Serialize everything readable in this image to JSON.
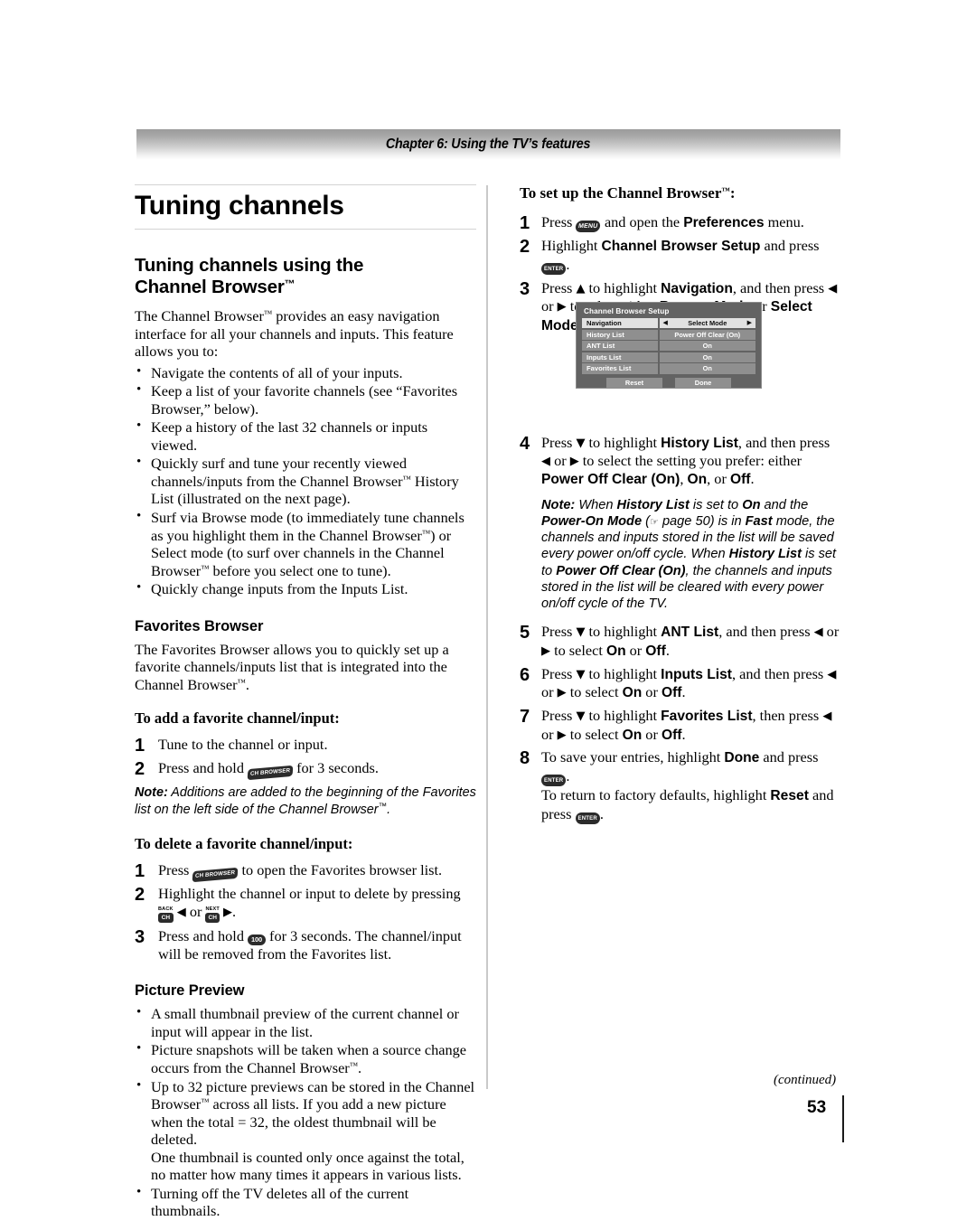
{
  "header": {
    "chapter_title": "Chapter 6: Using the TV’s features"
  },
  "left_column": {
    "h1": "Tuning channels",
    "h2_line1": "Tuning channels using the",
    "h2_line2": "Channel Browser",
    "intro": "The Channel Browser™ provides an easy navigation interface for all your channels and inputs. This feature allows you to:",
    "intro_bullets": [
      "Navigate the contents of all of your inputs.",
      "Keep a list of your favorite channels (see “Favorites Browser,” below).",
      "Keep a history of the last 32 channels or inputs viewed.",
      "Quickly surf and tune your recently viewed channels/inputs from the Channel Browser™ History List (illustrated on the next page).",
      "Surf via Browse mode (to immediately tune channels as you highlight them in the Channel Browser™) or Select mode (to surf over channels in the Channel Browser™ before you select one to tune).",
      "Quickly change inputs from the Inputs List."
    ],
    "favorites_heading": "Favorites Browser",
    "favorites_intro": "The Favorites Browser allows you to quickly set up a favorite channels/inputs list that is integrated into the Channel Browser™.",
    "add_heading": "To add a favorite channel/input:",
    "add_steps": [
      {
        "num": "1",
        "text": "Tune to the channel or input."
      },
      {
        "num": "2",
        "text_before": "Press and hold",
        "key": "CH BROWSER",
        "text_after": "for 3 seconds."
      }
    ],
    "add_note_label": "Note:",
    "add_note_text": "Additions are added to the beginning of the Favorites list on the left side of the Channel Browser™.",
    "delete_heading": "To delete a favorite channel/input:",
    "delete_steps": [
      {
        "num": "1",
        "text_before": "Press",
        "key": "CH BROWSER",
        "text_after": "to open the Favorites browser list."
      },
      {
        "num": "2",
        "text_before": "Highlight the channel or input to delete by pressing",
        "key_back_cap": "BACK",
        "key_back": "CH",
        "arrow_left": "◀",
        "or": "or",
        "key_next_cap": "NEXT",
        "key_next": "CH",
        "arrow_right": "▶"
      },
      {
        "num": "3",
        "text_before": "Press and hold",
        "key": "100",
        "text_after": "for 3 seconds. The channel/input will be removed from the Favorites list."
      }
    ],
    "picture_preview_heading": "Picture Preview",
    "picture_preview_bullets": [
      "A small thumbnail preview of the current channel or input will appear in the list.",
      "Picture snapshots will be taken when a source change occurs from the Channel Browser™.",
      "Up to 32 picture previews can be stored in the Channel Browser™ across all lists. If you add a new picture when the total = 32, the oldest thumbnail will be deleted.\nOne thumbnail is counted only once against the total, no matter how many times it appears in various lists.",
      "Turning off the TV deletes all of the current thumbnails."
    ]
  },
  "right_column": {
    "setup_heading": "To set up the Channel Browser™:",
    "steps": [
      {
        "num": "1",
        "parts": [
          "Press ",
          "[MENU]",
          " and open the ",
          "Preferences",
          " menu."
        ]
      },
      {
        "num": "2",
        "parts": [
          "Highlight ",
          "Channel Browser Setup",
          " and press ",
          "[ENTER]",
          "."
        ]
      },
      {
        "num": "3",
        "parts": [
          "Press ▲ to highlight ",
          "Navigation",
          ", and then press ◀ or ▶ to select either ",
          "Browse Mode",
          " or ",
          "Select Mode",
          "."
        ]
      },
      {
        "num": "4",
        "parts": [
          "Press ▼ to highlight ",
          "History List",
          ", and then press ◀ or ▶ to select the setting you prefer: either ",
          "Power Off Clear (On)",
          ", ",
          "On",
          ", or ",
          "Off",
          "."
        ]
      },
      {
        "num": "5",
        "parts": [
          "Press ▼ to highlight ",
          "ANT List",
          ", and then press ◀ or ▶ to select ",
          "On",
          " or ",
          "Off",
          "."
        ]
      },
      {
        "num": "6",
        "parts": [
          "Press ▼ to highlight ",
          "Inputs List",
          ", and then press ◀ or ▶ to select ",
          "On",
          " or ",
          "Off",
          "."
        ]
      },
      {
        "num": "7",
        "parts": [
          "Press ▼ to highlight ",
          "Favorites List",
          ", then press ◀ or ▶ to select ",
          "On",
          " or ",
          "Off",
          "."
        ]
      },
      {
        "num": "8",
        "parts": [
          "To save your entries, highlight ",
          "Done",
          " and press ",
          "[ENTER]",
          ". To return to factory defaults, highlight ",
          "Reset",
          " and press ",
          "[ENTER]",
          "."
        ]
      }
    ],
    "note_label": "Note:",
    "note_text": "When History List is set to On and the Power-On Mode (☞ page 50) is in Fast mode, the channels and inputs stored in the list will be saved every power on/off cycle. When History List is set to Power Off Clear (On), the channels and inputs stored in the list will be cleared with every power on/off cycle of the TV.",
    "note_page_ref": "page 50"
  },
  "tv_menu": {
    "title": "Channel Browser Setup",
    "rows": [
      {
        "label": "Navigation",
        "value": "Select Mode",
        "selected": true,
        "arrows": true
      },
      {
        "label": "History List",
        "value": "Power Off Clear (On)",
        "selected": false,
        "arrows": false
      },
      {
        "label": "ANT List",
        "value": "On",
        "selected": false,
        "arrows": false
      },
      {
        "label": "Inputs List",
        "value": "On",
        "selected": false,
        "arrows": false
      },
      {
        "label": "Favorites List",
        "value": "On",
        "selected": false,
        "arrows": false
      }
    ],
    "buttons": [
      {
        "label": "Reset"
      },
      {
        "label": "Done"
      }
    ]
  },
  "footer": {
    "continued": "(continued)",
    "page_number": "53"
  }
}
